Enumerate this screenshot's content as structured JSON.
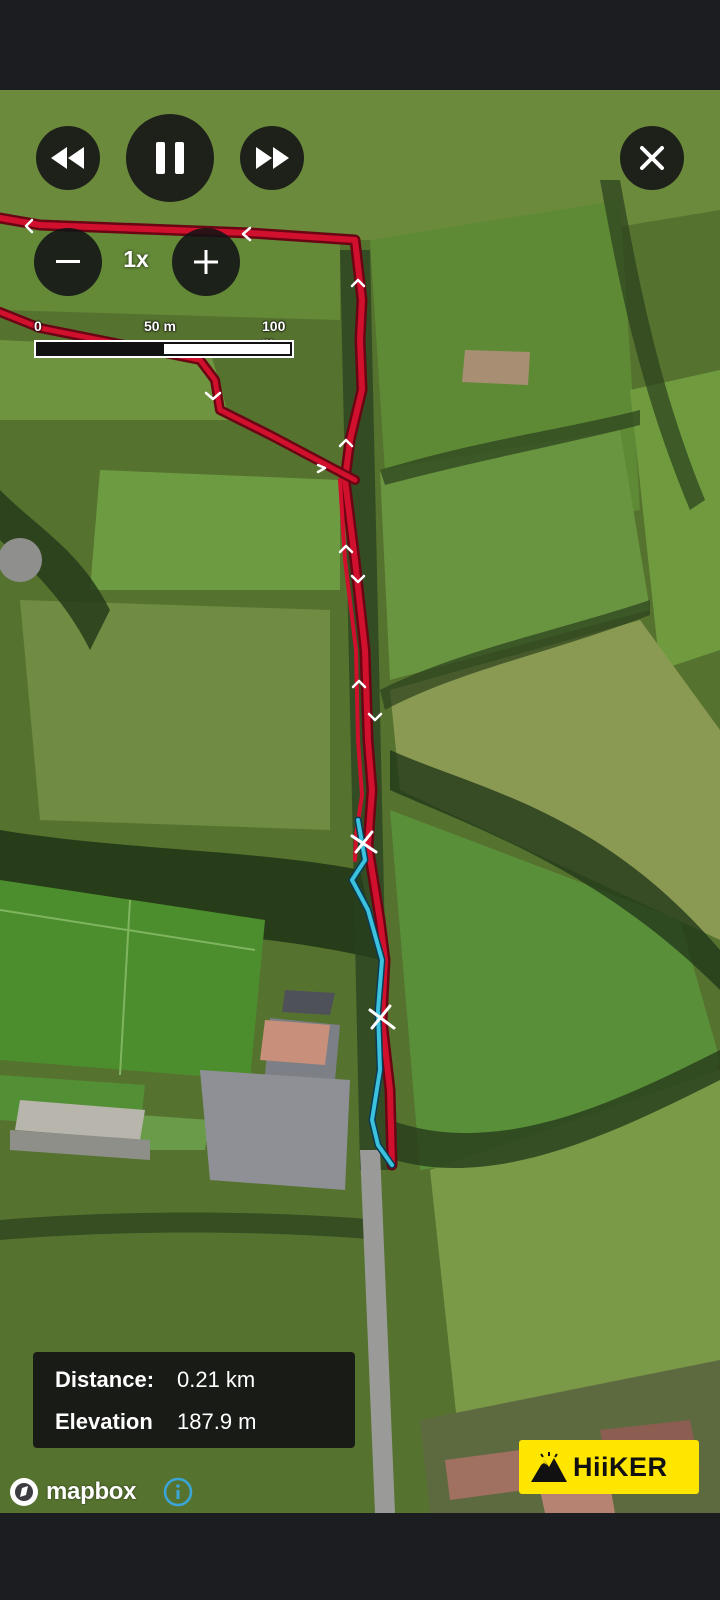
{
  "playback": {
    "speed_label": "1x"
  },
  "scale_bar": {
    "labels": [
      "0",
      "50 m",
      "100 m"
    ]
  },
  "info": {
    "distance_label": "Distance:",
    "distance_value": "0.21 km",
    "elevation_label": "Elevation",
    "elevation_value": "187.9 m"
  },
  "attribution": {
    "mapbox_label": "mapbox"
  },
  "branding": {
    "logo_text": "HiiKER"
  },
  "colors": {
    "route_recorded": "#d0102c",
    "route_progress": "#3cc2dc",
    "badge": "#ffe600",
    "control_bg": "#121214"
  },
  "icons": [
    "rewind-icon",
    "pause-icon",
    "fast-forward-icon",
    "close-icon",
    "minus-icon",
    "plus-icon",
    "info-icon",
    "mapbox-logo-icon",
    "mountain-icon"
  ]
}
